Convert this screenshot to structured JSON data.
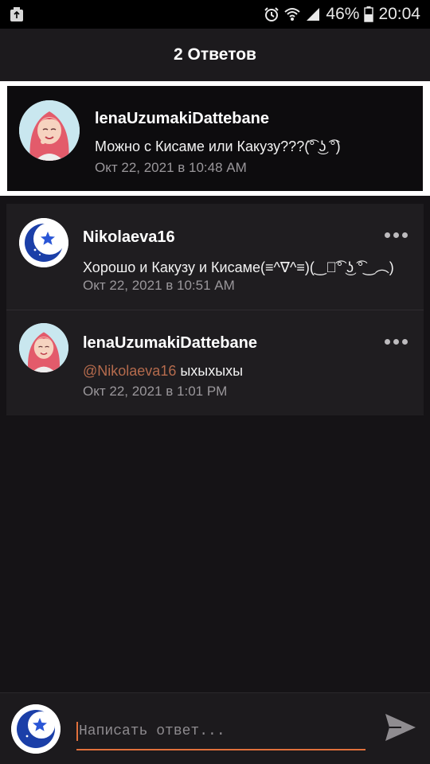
{
  "statusbar": {
    "battery_percent": "46%",
    "time": "20:04",
    "icons": [
      "recycle-icon",
      "alarm-icon",
      "wifi-icon",
      "signal-icon",
      "battery-icon"
    ]
  },
  "header": {
    "title": "2 Ответов"
  },
  "parent_comment": {
    "username": "lenaUzumakiDattebane",
    "text": "Можно с Кисаме или Какузу???(͡° ͜ʖ ͡°)",
    "time": "Окт 22, 2021 в 10:48 AM"
  },
  "replies": [
    {
      "username": "Nikolaeva16",
      "text": "Хорошо и Какузу и Кисаме(≡^∇^≡)(‿︵͡° ͜ʖ ͡°‿︵)",
      "time": "Окт 22, 2021 в 10:51 AM",
      "avatar": "moon-star-avatar"
    },
    {
      "username": "lenaUzumakiDattebane",
      "mention": "@Nikolaeva16",
      "text": " ыхыхыхы",
      "time": "Окт 22, 2021 в 1:01 PM",
      "avatar": "redhair-girl-avatar"
    }
  ],
  "composer": {
    "placeholder": "Написать ответ..."
  },
  "colors": {
    "accent": "#e1703c",
    "mention": "#b56b4d",
    "background": "#151316"
  }
}
